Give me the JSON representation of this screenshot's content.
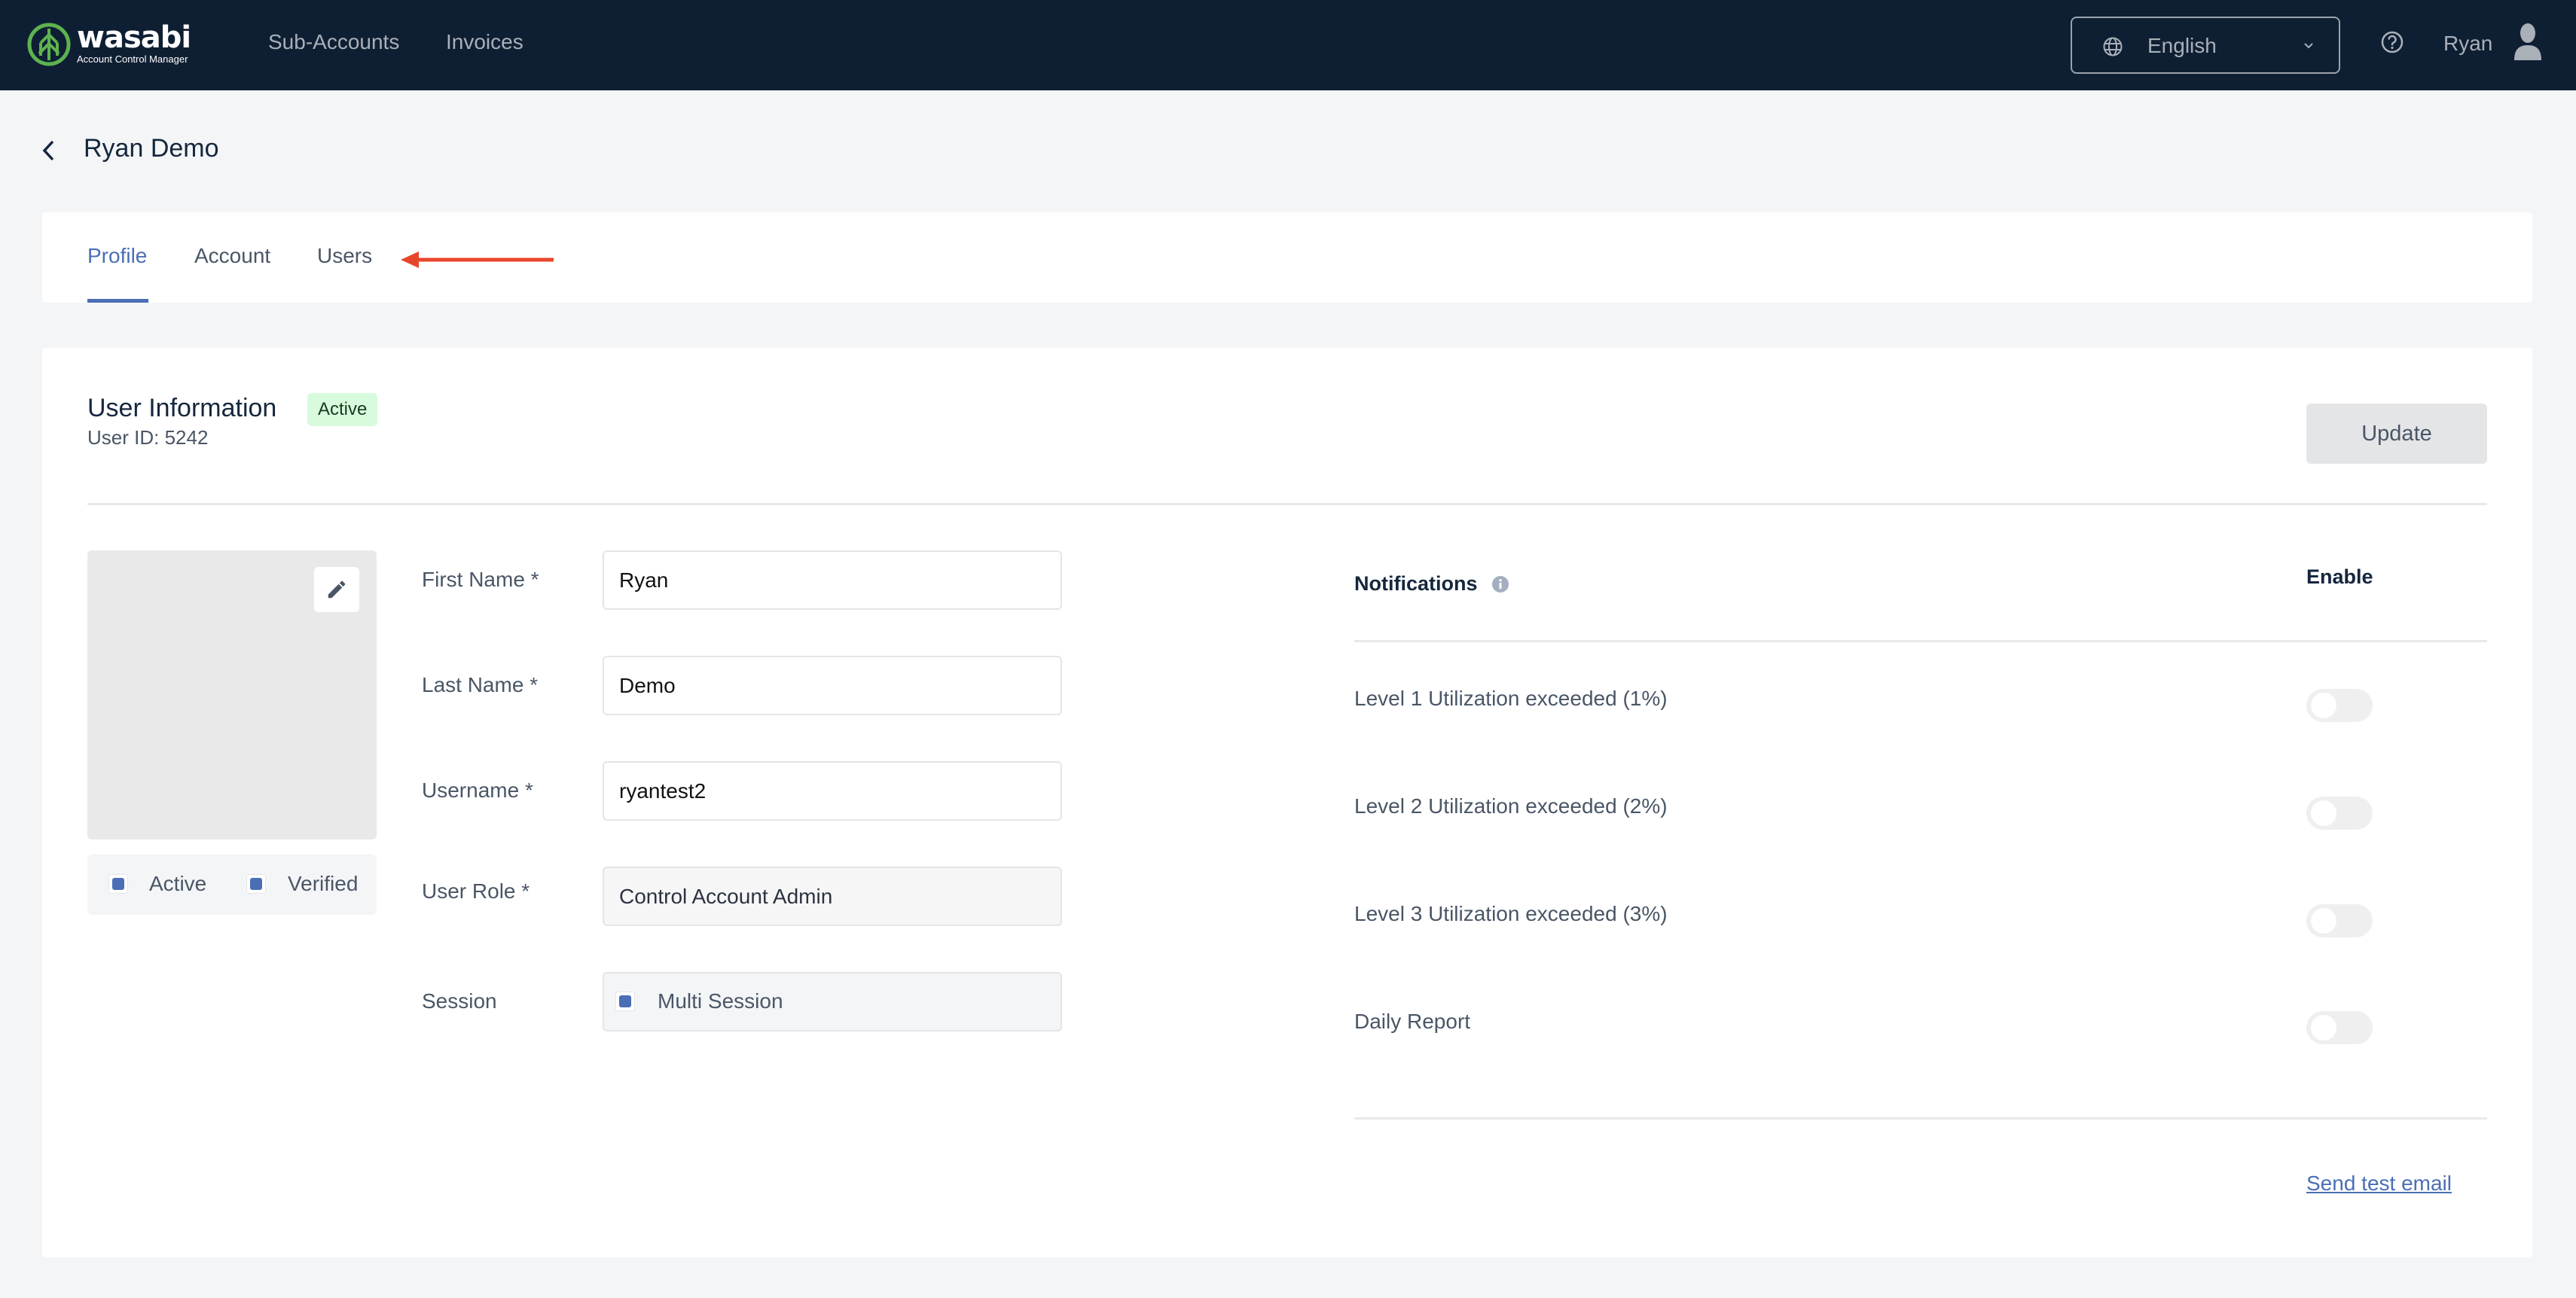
{
  "header": {
    "logo_word": "wasabi",
    "logo_subtitle": "Account Control Manager",
    "nav": [
      {
        "label": "Sub-Accounts"
      },
      {
        "label": "Invoices"
      }
    ],
    "language": "English",
    "user_name": "Ryan"
  },
  "page": {
    "title": "Ryan Demo"
  },
  "tabs": [
    {
      "label": "Profile",
      "active": true
    },
    {
      "label": "Account",
      "active": false
    },
    {
      "label": "Users",
      "active": false
    }
  ],
  "user_info": {
    "title": "User Information",
    "status_badge": "Active",
    "user_id": "User ID: 5242",
    "update_label": "Update",
    "status_checks": [
      {
        "label": "Active",
        "checked": true
      },
      {
        "label": "Verified",
        "checked": true
      }
    ]
  },
  "form": {
    "first_name": {
      "label": "First Name *",
      "value": "Ryan"
    },
    "last_name": {
      "label": "Last Name *",
      "value": "Demo"
    },
    "username": {
      "label": "Username *",
      "value": "ryantest2"
    },
    "user_role": {
      "label": "User Role *",
      "value": "Control Account Admin"
    },
    "session": {
      "label": "Session",
      "value": "Multi Session",
      "checked": true
    }
  },
  "notifications": {
    "header": "Notifications",
    "enable_header": "Enable",
    "items": [
      {
        "label": "Level 1 Utilization exceeded (1%)",
        "enabled": false
      },
      {
        "label": "Level 2 Utilization exceeded (2%)",
        "enabled": false
      },
      {
        "label": "Level 3 Utilization exceeded (3%)",
        "enabled": false
      },
      {
        "label": "Daily Report",
        "enabled": false
      }
    ],
    "send_test_label": "Send test email"
  },
  "colors": {
    "header_bg": "#0f1f33",
    "accent": "#4a6fb5",
    "badge_bg": "#d7fbdc",
    "annotation_arrow": "#e8462b"
  }
}
